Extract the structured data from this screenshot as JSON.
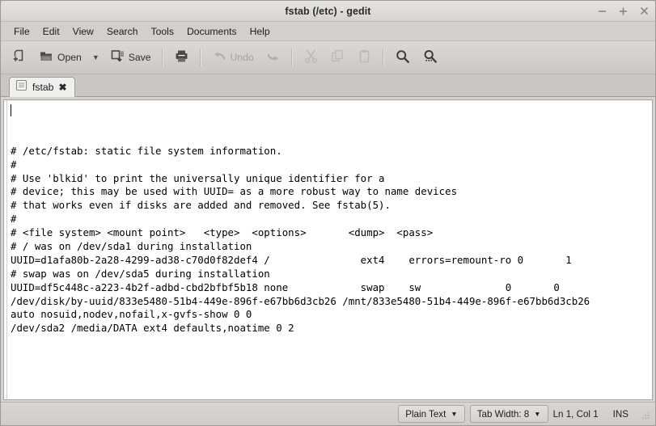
{
  "window": {
    "title": "fstab (/etc) - gedit",
    "controls": [
      {
        "name": "minimize",
        "glyph": "minimize-icon"
      },
      {
        "name": "maximize",
        "glyph": "maximize-icon"
      },
      {
        "name": "close",
        "glyph": "close-icon"
      }
    ]
  },
  "menubar": {
    "items": [
      {
        "label": "File"
      },
      {
        "label": "Edit"
      },
      {
        "label": "View"
      },
      {
        "label": "Search"
      },
      {
        "label": "Tools"
      },
      {
        "label": "Documents"
      },
      {
        "label": "Help"
      }
    ]
  },
  "toolbar": {
    "new_label": "",
    "open_label": "Open",
    "open_dropdown": "▼",
    "save_label": "Save",
    "print_label": "",
    "undo_label": "Undo",
    "redo_label": "",
    "cut_label": "",
    "copy_label": "",
    "paste_label": "",
    "find_label": "",
    "replace_label": "",
    "icons": {
      "new": "new-document-icon",
      "open": "open-folder-icon",
      "save": "save-icon",
      "print": "print-icon",
      "undo": "undo-arrow-icon",
      "redo": "redo-arrow-icon",
      "cut": "scissors-icon",
      "copy": "copy-icon",
      "paste": "clipboard-icon",
      "find": "search-icon",
      "replace": "search-replace-icon"
    }
  },
  "tabs": [
    {
      "label": "fstab",
      "close": "✖",
      "icon": "document-icon",
      "active": true
    }
  ],
  "document": {
    "lines": [
      "# /etc/fstab: static file system information.",
      "#",
      "# Use 'blkid' to print the universally unique identifier for a",
      "# device; this may be used with UUID= as a more robust way to name devices",
      "# that works even if disks are added and removed. See fstab(5).",
      "#",
      "# <file system> <mount point>   <type>  <options>       <dump>  <pass>",
      "# / was on /dev/sda1 during installation",
      "UUID=d1afa80b-2a28-4299-ad38-c70d0f82def4 /               ext4    errors=remount-ro 0       1",
      "# swap was on /dev/sda5 during installation",
      "UUID=df5c448c-a223-4b2f-adbd-cbd2bfbf5b18 none            swap    sw              0       0",
      "/dev/disk/by-uuid/833e5480-51b4-449e-896f-e67bb6d3cb26 /mnt/833e5480-51b4-449e-896f-e67bb6d3cb26",
      "auto nosuid,nodev,nofail,x-gvfs-show 0 0",
      "/dev/sda2 /media/DATA ext4 defaults,noatime 0 2"
    ]
  },
  "statusbar": {
    "language": "Plain Text",
    "language_arrow": "▼",
    "tab_width": "Tab Width: 8",
    "tab_width_arrow": "▼",
    "position": "Ln 1, Col 1",
    "insert_mode": "INS"
  },
  "colors": {
    "titlebar": "#dedbd8",
    "toolbar": "#d3d0cd",
    "menubar": "#d2cfcc",
    "editor_bg": "#ffffff",
    "text": "#000000",
    "statusbar": "#d4d1ce"
  }
}
